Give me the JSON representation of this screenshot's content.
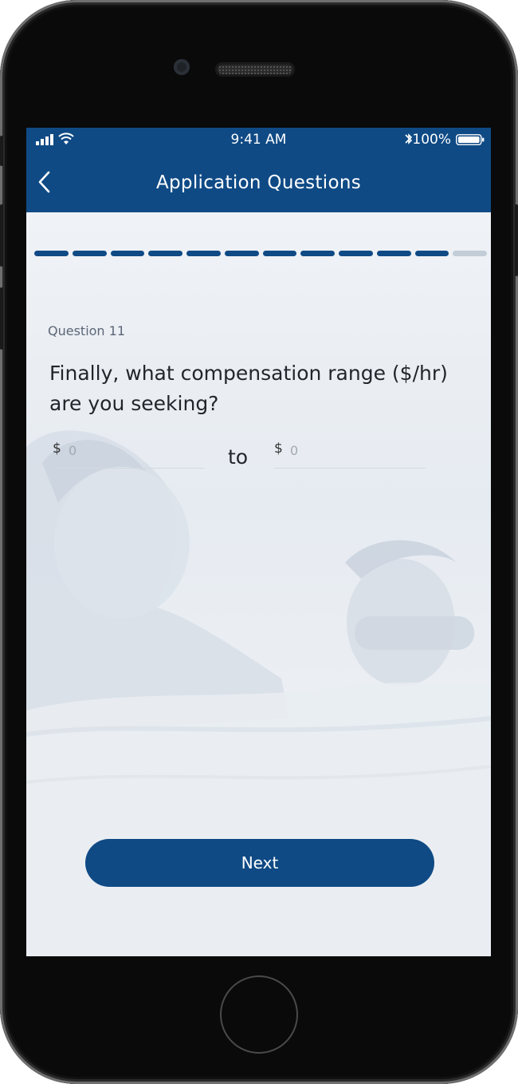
{
  "status_bar": {
    "time": "9:41 AM",
    "battery": "100%"
  },
  "nav": {
    "title": "Application Questions",
    "back_icon": "chevron-left-icon"
  },
  "progress": {
    "total_steps": 12,
    "completed_steps": 11,
    "active_color": "#0f4a85",
    "inactive_color": "#c3cdd8"
  },
  "question": {
    "label": "Question 11",
    "text": "Finally, what compensation range ($/hr) are you seeking?"
  },
  "range": {
    "min_prefix": "$",
    "min_placeholder": "0",
    "separator": "to",
    "max_prefix": "$",
    "max_placeholder": "0"
  },
  "next_button": {
    "label": "Next"
  },
  "colors": {
    "brand": "#0f4a85"
  }
}
